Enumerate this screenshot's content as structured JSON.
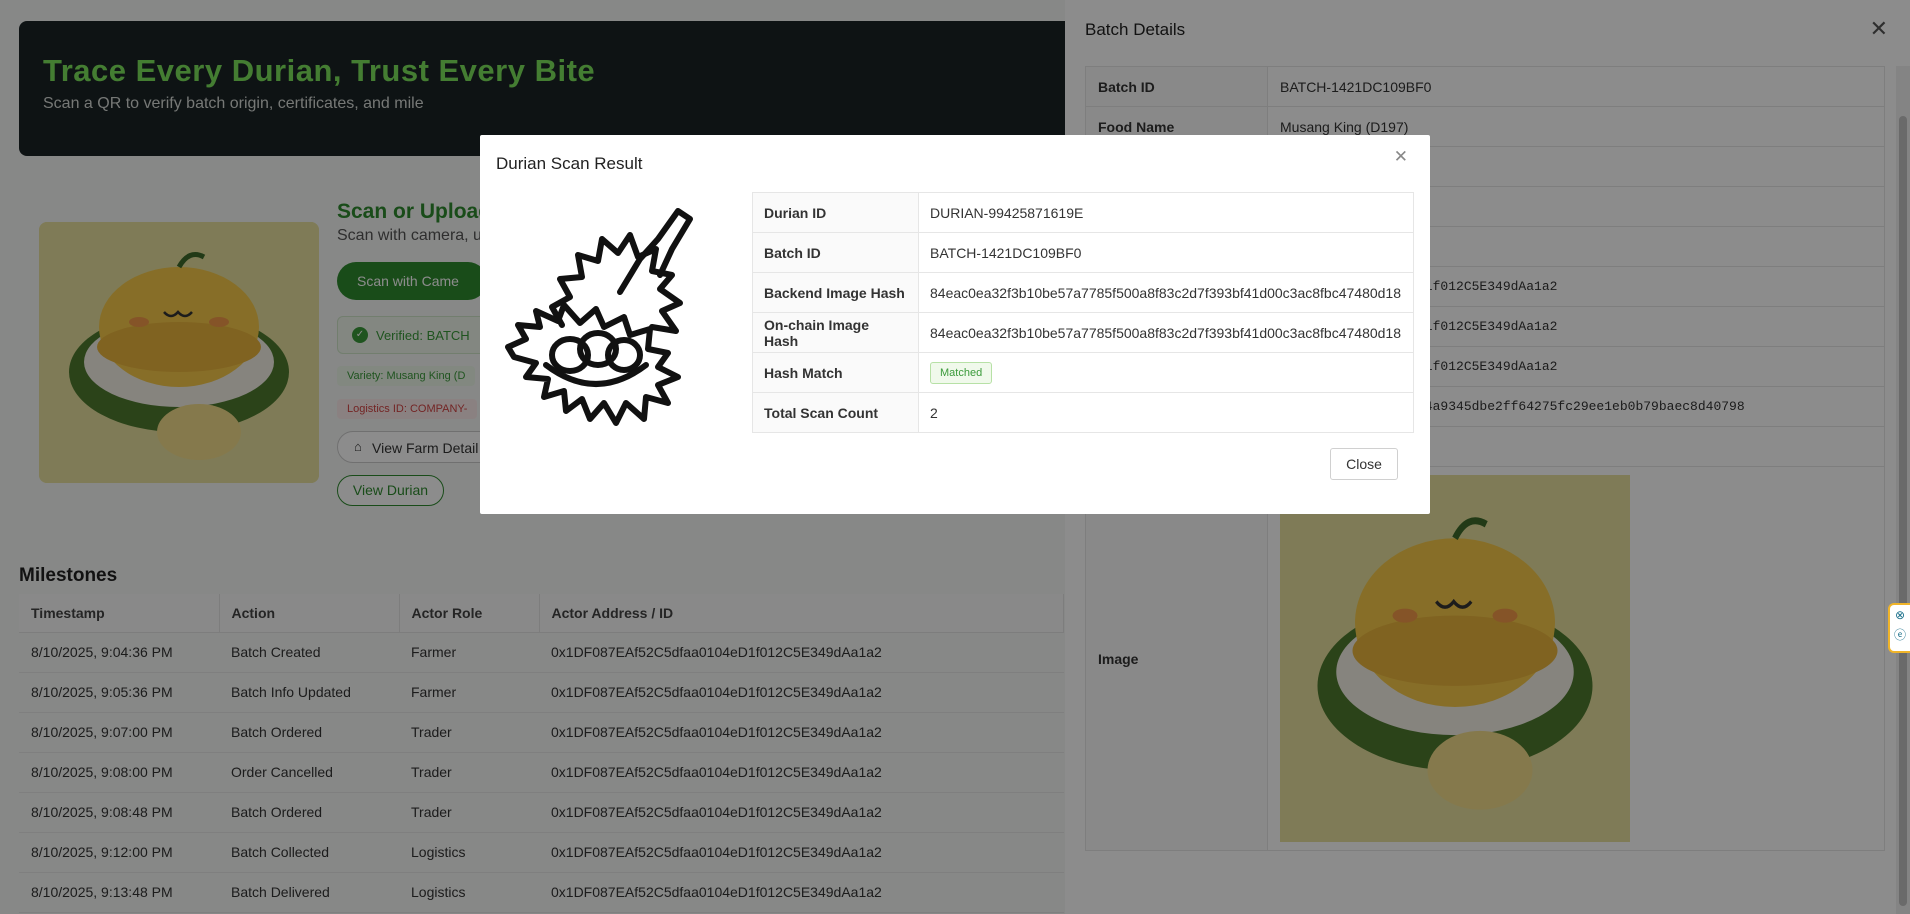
{
  "hero": {
    "title": "Trace Every Durian, Trust Every Bite",
    "subtitle": "Scan a QR to verify batch origin, certificates, and mile"
  },
  "scan": {
    "heading": "Scan or Upload",
    "subtitle": "Scan with camera, u",
    "camera_button": "Scan with Came",
    "verified_text": "Verified: BATCH",
    "variety_tag": "Variety: Musang King (D",
    "logistics_tag": "Logistics ID: COMPANY-",
    "farm_button": "View Farm Detail",
    "durian_button": "View Durian"
  },
  "milestones": {
    "title": "Milestones",
    "columns": [
      "Timestamp",
      "Action",
      "Actor Role",
      "Actor Address / ID"
    ],
    "rows": [
      [
        "8/10/2025, 9:04:36 PM",
        "Batch Created",
        "Farmer",
        "0x1DF087EAf52C5dfaa0104eD1f012C5E349dAa1a2"
      ],
      [
        "8/10/2025, 9:05:36 PM",
        "Batch Info Updated",
        "Farmer",
        "0x1DF087EAf52C5dfaa0104eD1f012C5E349dAa1a2"
      ],
      [
        "8/10/2025, 9:07:00 PM",
        "Batch Ordered",
        "Trader",
        "0x1DF087EAf52C5dfaa0104eD1f012C5E349dAa1a2"
      ],
      [
        "8/10/2025, 9:08:00 PM",
        "Order Cancelled",
        "Trader",
        "0x1DF087EAf52C5dfaa0104eD1f012C5E349dAa1a2"
      ],
      [
        "8/10/2025, 9:08:48 PM",
        "Batch Ordered",
        "Trader",
        "0x1DF087EAf52C5dfaa0104eD1f012C5E349dAa1a2"
      ],
      [
        "8/10/2025, 9:12:00 PM",
        "Batch Collected",
        "Logistics",
        "0x1DF087EAf52C5dfaa0104eD1f012C5E349dAa1a2"
      ],
      [
        "8/10/2025, 9:13:48 PM",
        "Batch Delivered",
        "Logistics",
        "0x1DF087EAf52C5dfaa0104eD1f012C5E349dAa1a2"
      ]
    ]
  },
  "drawer": {
    "title": "Batch Details",
    "close_icon": "close-icon",
    "rows": [
      {
        "key": "Batch ID",
        "value": "BATCH-1421DC109BF0"
      },
      {
        "key": "Food Name",
        "value": "Musang King (D197)"
      },
      {
        "key": "",
        "value": ""
      },
      {
        "key": "",
        "value": ""
      },
      {
        "key": "",
        "value": ""
      },
      {
        "key": "",
        "value": "0104eD1f012C5E349dAa1a2"
      },
      {
        "key": "",
        "value": "0104eD1f012C5E349dAa1a2"
      },
      {
        "key": "",
        "value": "0104eD1f012C5E349dAa1a2"
      },
      {
        "key": "",
        "value": "58d9164a9345dbe2ff64275fc29ee1eb0b79baec8d40798"
      },
      {
        "key": "",
        "value": ""
      }
    ],
    "image_label": "Image"
  },
  "modal": {
    "title": "Durian Scan Result",
    "close_icon": "close-icon",
    "rows": [
      {
        "key": "Durian ID",
        "value": "DURIAN-99425871619E"
      },
      {
        "key": "Batch ID",
        "value": "BATCH-1421DC109BF0"
      },
      {
        "key": "Backend Image Hash",
        "value": "84eac0ea32f3b10be57a7785f500a8f83c2d7f393bf41d00c3ac8fbc47480d18"
      },
      {
        "key": "On-chain Image Hash",
        "value": "84eac0ea32f3b10be57a7785f500a8f83c2d7f393bf41d00c3ac8fbc47480d18"
      },
      {
        "key": "Hash Match",
        "value": "Matched"
      },
      {
        "key": "Total Scan Count",
        "value": "2"
      }
    ],
    "close_button": "Close"
  },
  "colors": {
    "accent_green": "#2f8a2f",
    "hero_title": "#7de35c",
    "hero_bg": "#1a2326",
    "badge_green": "#3a9a3a"
  }
}
